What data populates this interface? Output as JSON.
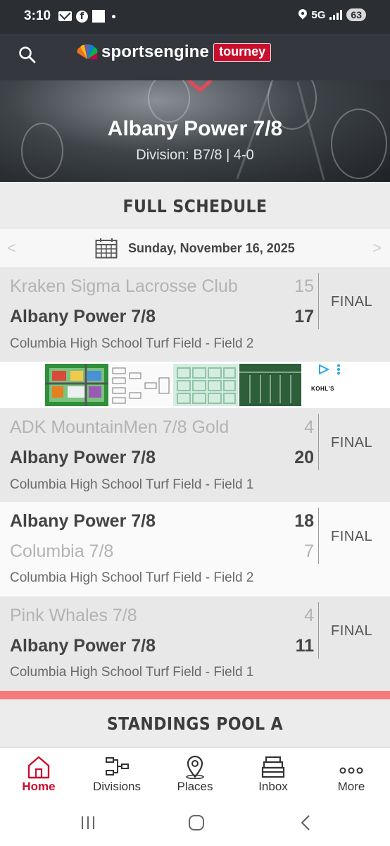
{
  "status_bar": {
    "time": "3:10",
    "network": "5G",
    "battery": "63",
    "colors": {
      "background": "#2b2e33"
    }
  },
  "header": {
    "brand_name": "sportsengine",
    "brand_badge": "tourney",
    "icons": {
      "search": "search-icon",
      "logo": "peacock-logo-icon"
    },
    "colors": {
      "background": "#34373d",
      "badge": "#c8102e"
    }
  },
  "team": {
    "name": "Albany Power 7/8",
    "division_line": "Division: B7/8 | 4-0"
  },
  "schedule": {
    "heading": "FULL SCHEDULE",
    "date": "Sunday, November 16, 2025",
    "prev_label": "<",
    "next_label": ">",
    "games": [
      {
        "team1": "Kraken Sigma Lacrosse Club",
        "score1": "15",
        "team2": "Albany Power 7/8",
        "score2": "17",
        "location": "Columbia High School Turf Field - Field 2",
        "status": "FINAL",
        "winner": 2
      },
      {
        "team1": "ADK MountainMen 7/8 Gold",
        "score1": "4",
        "team2": "Albany Power 7/8",
        "score2": "20",
        "location": "Columbia High School Turf Field - Field 1",
        "status": "FINAL",
        "winner": 2
      },
      {
        "team1": "Albany Power 7/8",
        "score1": "18",
        "team2": "Columbia 7/8",
        "score2": "7",
        "location": "Columbia High School Turf Field - Field 2",
        "status": "FINAL",
        "winner": 1
      },
      {
        "team1": "Pink Whales 7/8",
        "score1": "4",
        "team2": "Albany Power 7/8",
        "score2": "11",
        "location": "Columbia High School Turf Field - Field 1",
        "status": "FINAL",
        "winner": 2
      }
    ]
  },
  "ad": {
    "advertiser": "KOHL'S",
    "icons": {
      "adchoices": "adchoices-icon",
      "menu": "more-vert-icon"
    }
  },
  "standings": {
    "heading": "STANDINGS POOL A"
  },
  "bottom_nav": {
    "items": [
      {
        "label": "Home",
        "icon": "home-icon",
        "active": true
      },
      {
        "label": "Divisions",
        "icon": "bracket-icon",
        "active": false
      },
      {
        "label": "Places",
        "icon": "location-pin-icon",
        "active": false
      },
      {
        "label": "Inbox",
        "icon": "inbox-icon",
        "active": false
      },
      {
        "label": "More",
        "icon": "more-dots-icon",
        "active": false
      }
    ],
    "colors": {
      "active": "#c8102e"
    }
  },
  "system_nav": {
    "icons": [
      "recent-apps-icon",
      "home-circle-icon",
      "back-icon"
    ]
  }
}
